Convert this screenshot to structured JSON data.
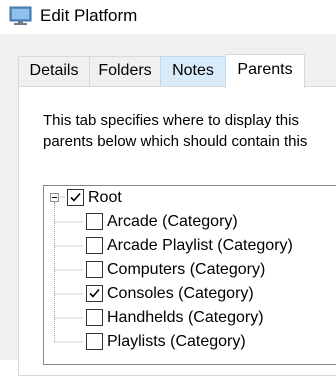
{
  "window": {
    "title": "Edit Platform",
    "icon": "monitor-icon"
  },
  "tabs": [
    {
      "label": "Details",
      "state": "normal"
    },
    {
      "label": "Folders",
      "state": "normal"
    },
    {
      "label": "Notes",
      "state": "hover"
    },
    {
      "label": "Parents",
      "state": "selected"
    }
  ],
  "parents_tab": {
    "description_line1": "This tab specifies where to display this",
    "description_line2": "parents below which should contain this"
  },
  "tree": {
    "root": {
      "label": "Root",
      "checked": true,
      "expanded": true
    },
    "children": [
      {
        "label": "Arcade (Category)",
        "checked": false
      },
      {
        "label": "Arcade Playlist (Category)",
        "checked": false
      },
      {
        "label": "Computers (Category)",
        "checked": false
      },
      {
        "label": "Consoles (Category)",
        "checked": true
      },
      {
        "label": "Handhelds (Category)",
        "checked": false
      },
      {
        "label": "Playlists (Category)",
        "checked": false
      }
    ]
  },
  "colors": {
    "dialog_background": "#f0f0f0",
    "tab_hover": "#d9ebf9",
    "tree_border": "#828790"
  }
}
